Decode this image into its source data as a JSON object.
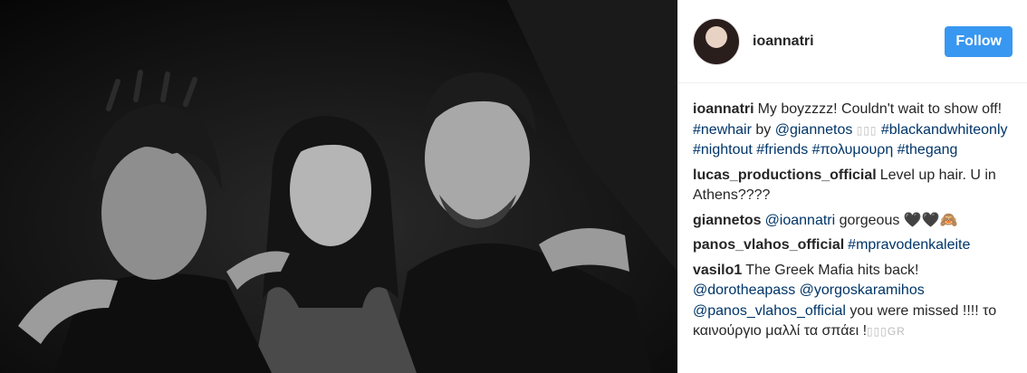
{
  "post": {
    "username": "ioannatri",
    "follow_label": "Follow",
    "comments": [
      {
        "user": "ioannatri",
        "parts": [
          {
            "text": "My boyzzzz! Couldn't wait to show off! ",
            "type": "text"
          },
          {
            "text": "#newhair",
            "type": "link"
          },
          {
            "text": " by ",
            "type": "text"
          },
          {
            "text": "@giannetos",
            "type": "link"
          },
          {
            "text": " ▯▯▯ ",
            "type": "sym"
          },
          {
            "text": "#blackandwhiteonly",
            "type": "link"
          },
          {
            "text": " ",
            "type": "text"
          },
          {
            "text": "#nightout",
            "type": "link"
          },
          {
            "text": " ",
            "type": "text"
          },
          {
            "text": "#friends",
            "type": "link"
          },
          {
            "text": " ",
            "type": "text"
          },
          {
            "text": "#πολυμουρη",
            "type": "link"
          },
          {
            "text": " ",
            "type": "text"
          },
          {
            "text": "#thegang",
            "type": "link"
          }
        ]
      },
      {
        "user": "lucas_productions_official",
        "parts": [
          {
            "text": "Level up hair. U in Athens????",
            "type": "text"
          }
        ]
      },
      {
        "user": "giannetos",
        "parts": [
          {
            "text": "@ioannatri",
            "type": "link"
          },
          {
            "text": " gorgeous 🖤🖤🙈",
            "type": "text"
          }
        ]
      },
      {
        "user": "panos_vlahos_official",
        "parts": [
          {
            "text": "#mpravodenkaleite",
            "type": "link"
          }
        ]
      },
      {
        "user": "vasilo1",
        "parts": [
          {
            "text": "The Greek Mafia hits back! ",
            "type": "text"
          },
          {
            "text": "@dorotheapass",
            "type": "link"
          },
          {
            "text": " ",
            "type": "text"
          },
          {
            "text": "@yorgoskaramihos",
            "type": "link"
          },
          {
            "text": " ",
            "type": "text"
          },
          {
            "text": "@panos_vlahos_official",
            "type": "link"
          },
          {
            "text": " you were missed !!!! το καινούργιο μαλλί τα σπάει !",
            "type": "text"
          },
          {
            "text": "▯▯▯GR",
            "type": "sym"
          }
        ]
      }
    ]
  }
}
